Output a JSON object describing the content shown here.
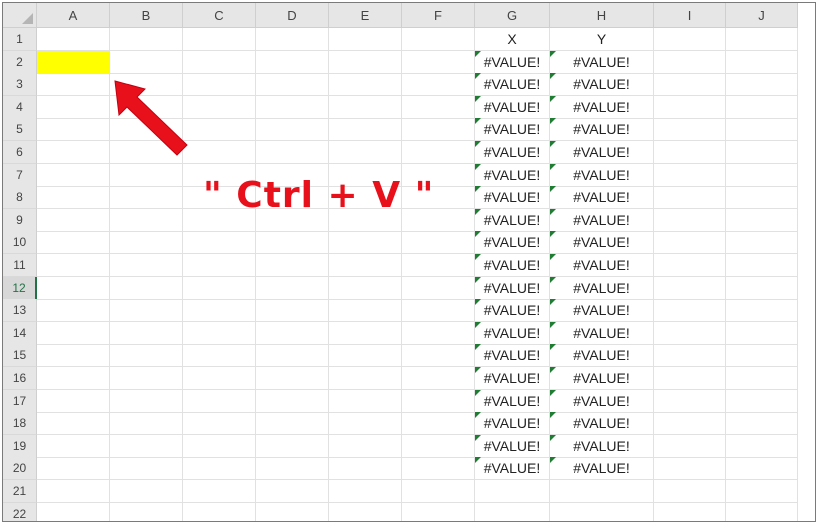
{
  "columns": [
    "A",
    "B",
    "C",
    "D",
    "E",
    "F",
    "G",
    "H",
    "I",
    "J"
  ],
  "rows": [
    "1",
    "2",
    "3",
    "4",
    "5",
    "6",
    "7",
    "8",
    "9",
    "10",
    "11",
    "12",
    "13",
    "14",
    "15",
    "16",
    "17",
    "18",
    "19",
    "20",
    "21",
    "22"
  ],
  "active_row": "12",
  "highlighted_cell": "A2",
  "highlight_color": "#ffff00",
  "headers": {
    "G1": "X",
    "H1": "Y"
  },
  "error_value": "#VALUE!",
  "error_rows": [
    "2",
    "3",
    "4",
    "5",
    "6",
    "7",
    "8",
    "9",
    "10",
    "11",
    "12",
    "13",
    "14",
    "15",
    "16",
    "17",
    "18",
    "19",
    "20"
  ],
  "annotation": {
    "text": "\" Ctrl + V \"",
    "color": "#e8101a",
    "arrow": "arrow-icon pointing to A2"
  }
}
